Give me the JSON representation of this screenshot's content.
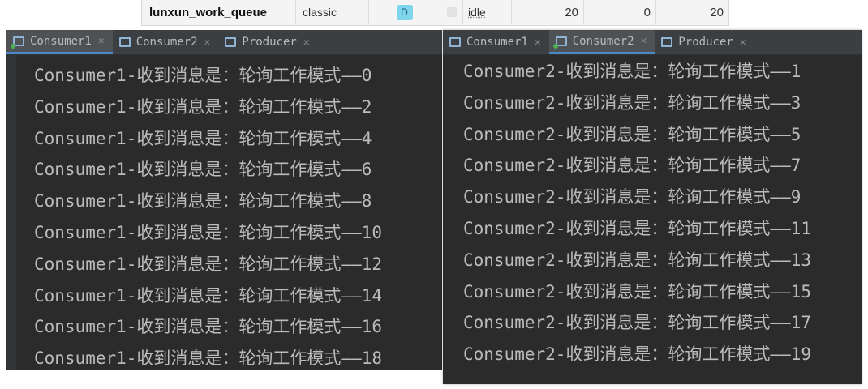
{
  "queue_row": {
    "name": "lunxun_work_queue",
    "type": "classic",
    "features_badge": "D",
    "state": "idle",
    "ready": "20",
    "unacked": "0",
    "total": "20"
  },
  "left_panel": {
    "tabs": [
      {
        "label": "Consumer1",
        "active": true
      },
      {
        "label": "Consumer2",
        "active": false
      },
      {
        "label": "Producer",
        "active": false
      }
    ],
    "lines": [
      "Consumer1-收到消息是：轮询工作模式——0",
      "Consumer1-收到消息是：轮询工作模式——2",
      "Consumer1-收到消息是：轮询工作模式——4",
      "Consumer1-收到消息是：轮询工作模式——6",
      "Consumer1-收到消息是：轮询工作模式——8",
      "Consumer1-收到消息是：轮询工作模式——10",
      "Consumer1-收到消息是：轮询工作模式——12",
      "Consumer1-收到消息是：轮询工作模式——14",
      "Consumer1-收到消息是：轮询工作模式——16",
      "Consumer1-收到消息是：轮询工作模式——18"
    ]
  },
  "right_panel": {
    "tabs": [
      {
        "label": "Consumer1",
        "active": false
      },
      {
        "label": "Consumer2",
        "active": true
      },
      {
        "label": "Producer",
        "active": false
      }
    ],
    "lines": [
      "Consumer2-收到消息是：轮询工作模式——1",
      "Consumer2-收到消息是：轮询工作模式——3",
      "Consumer2-收到消息是：轮询工作模式——5",
      "Consumer2-收到消息是：轮询工作模式——7",
      "Consumer2-收到消息是：轮询工作模式——9",
      "Consumer2-收到消息是：轮询工作模式——11",
      "Consumer2-收到消息是：轮询工作模式——13",
      "Consumer2-收到消息是：轮询工作模式——15",
      "Consumer2-收到消息是：轮询工作模式——17",
      "Consumer2-收到消息是：轮询工作模式——19"
    ]
  },
  "colors": {
    "console_bg": "#2b2b2b",
    "tabbar_bg": "#3c3f41",
    "active_tab_underline": "#4a88c7",
    "console_text": "#bbbbbb",
    "run_indicator": "#4caf50",
    "durable_badge": "#7fd6ec"
  },
  "icons": {
    "tab": "run-console-icon",
    "close": "close-icon"
  }
}
